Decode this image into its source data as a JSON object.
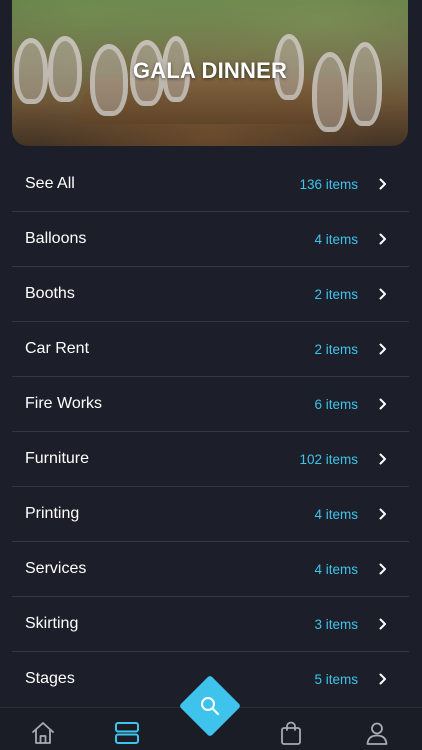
{
  "banner": {
    "title": "GALA DINNER"
  },
  "categories": [
    {
      "label": "See All",
      "count": "136 items"
    },
    {
      "label": "Balloons",
      "count": "4 items"
    },
    {
      "label": "Booths",
      "count": "2 items"
    },
    {
      "label": "Car Rent",
      "count": "2 items"
    },
    {
      "label": "Fire Works",
      "count": "6 items"
    },
    {
      "label": "Furniture",
      "count": "102 items"
    },
    {
      "label": "Printing",
      "count": "4 items"
    },
    {
      "label": "Services",
      "count": "4 items"
    },
    {
      "label": "Skirting",
      "count": "3 items"
    },
    {
      "label": "Stages",
      "count": "5 items"
    }
  ],
  "bottom_nav": {
    "items": [
      {
        "icon": "home-icon"
      },
      {
        "icon": "categories-icon",
        "active": true
      },
      {
        "icon": "search-icon"
      },
      {
        "icon": "shopping-bag-icon"
      },
      {
        "icon": "profile-icon"
      }
    ]
  },
  "colors": {
    "background": "#1c1f29",
    "accent": "#3ec3ec",
    "divider": "#343846",
    "text": "#ffffff",
    "icon_inactive": "#a8abb3"
  }
}
